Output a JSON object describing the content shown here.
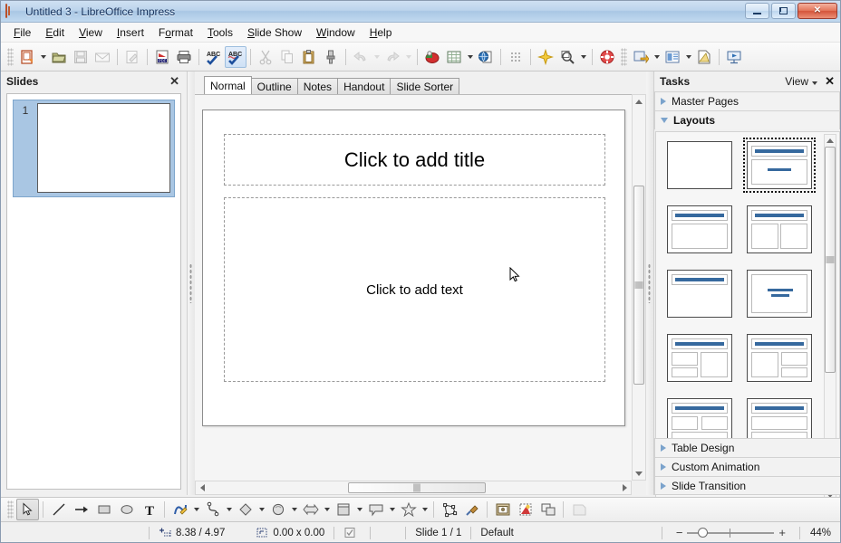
{
  "window": {
    "title": "Untitled 3 - LibreOffice Impress",
    "app_icon": "impress-document-icon",
    "controls": {
      "minimize": "minimize-icon",
      "restore": "restore-icon",
      "close": "✕"
    }
  },
  "menubar": {
    "items": [
      {
        "label": "File",
        "accel": "F"
      },
      {
        "label": "Edit",
        "accel": "E"
      },
      {
        "label": "View",
        "accel": "V"
      },
      {
        "label": "Insert",
        "accel": "I"
      },
      {
        "label": "Format",
        "accel": "o"
      },
      {
        "label": "Tools",
        "accel": "T"
      },
      {
        "label": "Slide Show",
        "accel": "S"
      },
      {
        "label": "Window",
        "accel": "W"
      },
      {
        "label": "Help",
        "accel": "H"
      }
    ]
  },
  "toolbar": {
    "buttons": [
      {
        "name": "new-document-icon",
        "enabled": true,
        "dropdown": true
      },
      {
        "name": "open-document-icon",
        "enabled": true,
        "dropdown": false
      },
      {
        "name": "save-document-icon",
        "enabled": false,
        "dropdown": false
      },
      {
        "name": "email-document-icon",
        "enabled": false,
        "dropdown": false
      },
      {
        "name": "edit-mode-icon",
        "enabled": false,
        "dropdown": false
      },
      {
        "name": "export-pdf-icon",
        "enabled": true,
        "dropdown": false
      },
      {
        "name": "print-icon",
        "enabled": true,
        "dropdown": false
      },
      {
        "name": "spelling-icon",
        "enabled": true,
        "dropdown": false
      },
      {
        "name": "autospellcheck-icon",
        "enabled": true,
        "dropdown": false,
        "pressed": true
      },
      {
        "name": "cut-icon",
        "enabled": false,
        "dropdown": false
      },
      {
        "name": "copy-icon",
        "enabled": false,
        "dropdown": false
      },
      {
        "name": "paste-icon",
        "enabled": true,
        "dropdown": false
      },
      {
        "name": "clone-formatting-icon",
        "enabled": true,
        "dropdown": false
      },
      {
        "name": "undo-icon",
        "enabled": false,
        "dropdown": true
      },
      {
        "name": "redo-icon",
        "enabled": false,
        "dropdown": true
      },
      {
        "name": "insert-chart-icon",
        "enabled": true,
        "dropdown": false
      },
      {
        "name": "insert-table-icon",
        "enabled": true,
        "dropdown": true
      },
      {
        "name": "insert-hyperlink-icon",
        "enabled": true,
        "dropdown": false
      },
      {
        "name": "display-grid-icon",
        "enabled": true,
        "dropdown": false
      },
      {
        "name": "start-slideshow-icon",
        "enabled": true,
        "dropdown": false
      },
      {
        "name": "zoom-icon",
        "enabled": true,
        "dropdown": true
      },
      {
        "name": "help-icon",
        "enabled": true,
        "dropdown": false
      },
      {
        "name": "new-slide-icon",
        "enabled": true,
        "dropdown": true
      },
      {
        "name": "slide-layout-icon",
        "enabled": true,
        "dropdown": true
      },
      {
        "name": "master-slide-icon",
        "enabled": true,
        "dropdown": false
      },
      {
        "name": "start-from-first-slide-icon",
        "enabled": true,
        "dropdown": false
      }
    ]
  },
  "slides_panel": {
    "title": "Slides",
    "close_label": "✕",
    "slides": [
      {
        "number": "1",
        "selected": true
      }
    ]
  },
  "view_tabs": {
    "tabs": [
      {
        "label": "Normal",
        "active": true
      },
      {
        "label": "Outline",
        "active": false
      },
      {
        "label": "Notes",
        "active": false
      },
      {
        "label": "Handout",
        "active": false
      },
      {
        "label": "Slide Sorter",
        "active": false
      }
    ]
  },
  "slide_editor": {
    "title_placeholder": "Click to add title",
    "content_placeholder": "Click to add text",
    "cursor": "mouse-pointer-icon"
  },
  "tasks_panel": {
    "title": "Tasks",
    "view_label": "View",
    "close_label": "✕",
    "sections": [
      {
        "label": "Master Pages",
        "expanded": false
      },
      {
        "label": "Layouts",
        "expanded": true
      },
      {
        "label": "Table Design",
        "expanded": false
      },
      {
        "label": "Custom Animation",
        "expanded": false
      },
      {
        "label": "Slide Transition",
        "expanded": false
      }
    ],
    "layouts": [
      {
        "name": "blank-slide",
        "selected": false,
        "kind": "blank"
      },
      {
        "name": "title-content",
        "selected": true,
        "kind": "title-center-text"
      },
      {
        "name": "title-content-block",
        "selected": false,
        "kind": "title-one-box"
      },
      {
        "name": "title-two-content",
        "selected": false,
        "kind": "title-two-box"
      },
      {
        "name": "title-only",
        "selected": false,
        "kind": "title-only"
      },
      {
        "name": "centered-text",
        "selected": false,
        "kind": "centered-text"
      },
      {
        "name": "two-content-and-content",
        "selected": false,
        "kind": "two-left-one-right"
      },
      {
        "name": "content-and-two-content",
        "selected": false,
        "kind": "one-left-two-right"
      },
      {
        "name": "two-content-over-content",
        "selected": false,
        "kind": "two-over-one"
      },
      {
        "name": "content-over-content",
        "selected": false,
        "kind": "one-over-one"
      },
      {
        "name": "four-content",
        "selected": false,
        "kind": "partial-a"
      },
      {
        "name": "six-content",
        "selected": false,
        "kind": "partial-b"
      }
    ],
    "accent_color": "#36699e"
  },
  "draw_toolbar": {
    "buttons": [
      {
        "name": "select-tool-icon",
        "pressed": true,
        "dropdown": false,
        "enabled": true
      },
      {
        "name": "line-tool-icon",
        "pressed": false,
        "dropdown": false,
        "enabled": true
      },
      {
        "name": "arrow-line-tool-icon",
        "pressed": false,
        "dropdown": false,
        "enabled": true
      },
      {
        "name": "rectangle-tool-icon",
        "pressed": false,
        "dropdown": false,
        "enabled": true
      },
      {
        "name": "ellipse-tool-icon",
        "pressed": false,
        "dropdown": false,
        "enabled": true
      },
      {
        "name": "text-box-tool-icon",
        "pressed": false,
        "dropdown": false,
        "enabled": true
      },
      {
        "name": "curve-tool-icon",
        "pressed": false,
        "dropdown": true,
        "enabled": true
      },
      {
        "name": "connector-tool-icon",
        "pressed": false,
        "dropdown": true,
        "enabled": true
      },
      {
        "name": "basic-shapes-icon",
        "pressed": false,
        "dropdown": true,
        "enabled": true
      },
      {
        "name": "symbol-shapes-icon",
        "pressed": false,
        "dropdown": true,
        "enabled": true
      },
      {
        "name": "block-arrows-icon",
        "pressed": false,
        "dropdown": true,
        "enabled": true
      },
      {
        "name": "flowchart-shapes-icon",
        "pressed": false,
        "dropdown": true,
        "enabled": true
      },
      {
        "name": "callout-shapes-icon",
        "pressed": false,
        "dropdown": true,
        "enabled": true
      },
      {
        "name": "star-shapes-icon",
        "pressed": false,
        "dropdown": true,
        "enabled": true
      },
      {
        "name": "edit-points-icon",
        "pressed": false,
        "dropdown": false,
        "enabled": true
      },
      {
        "name": "glue-points-icon",
        "pressed": false,
        "dropdown": false,
        "enabled": true
      },
      {
        "name": "insert-image-icon",
        "pressed": false,
        "dropdown": false,
        "enabled": true
      },
      {
        "name": "rotate-icon",
        "pressed": false,
        "dropdown": false,
        "enabled": true
      },
      {
        "name": "align-objects-icon",
        "pressed": false,
        "dropdown": false,
        "enabled": true
      },
      {
        "name": "arrange-icon",
        "pressed": false,
        "dropdown": false,
        "enabled": false
      }
    ]
  },
  "statusbar": {
    "cursor_position": "8.38 / 4.97",
    "object_size": "0.00 x 0.00",
    "modified_icon": "document-modified-icon",
    "slide_counter": "Slide 1 / 1",
    "master_name": "Default",
    "zoom_out_label": "−",
    "zoom_in_label": "+",
    "zoom_level": "44%"
  }
}
